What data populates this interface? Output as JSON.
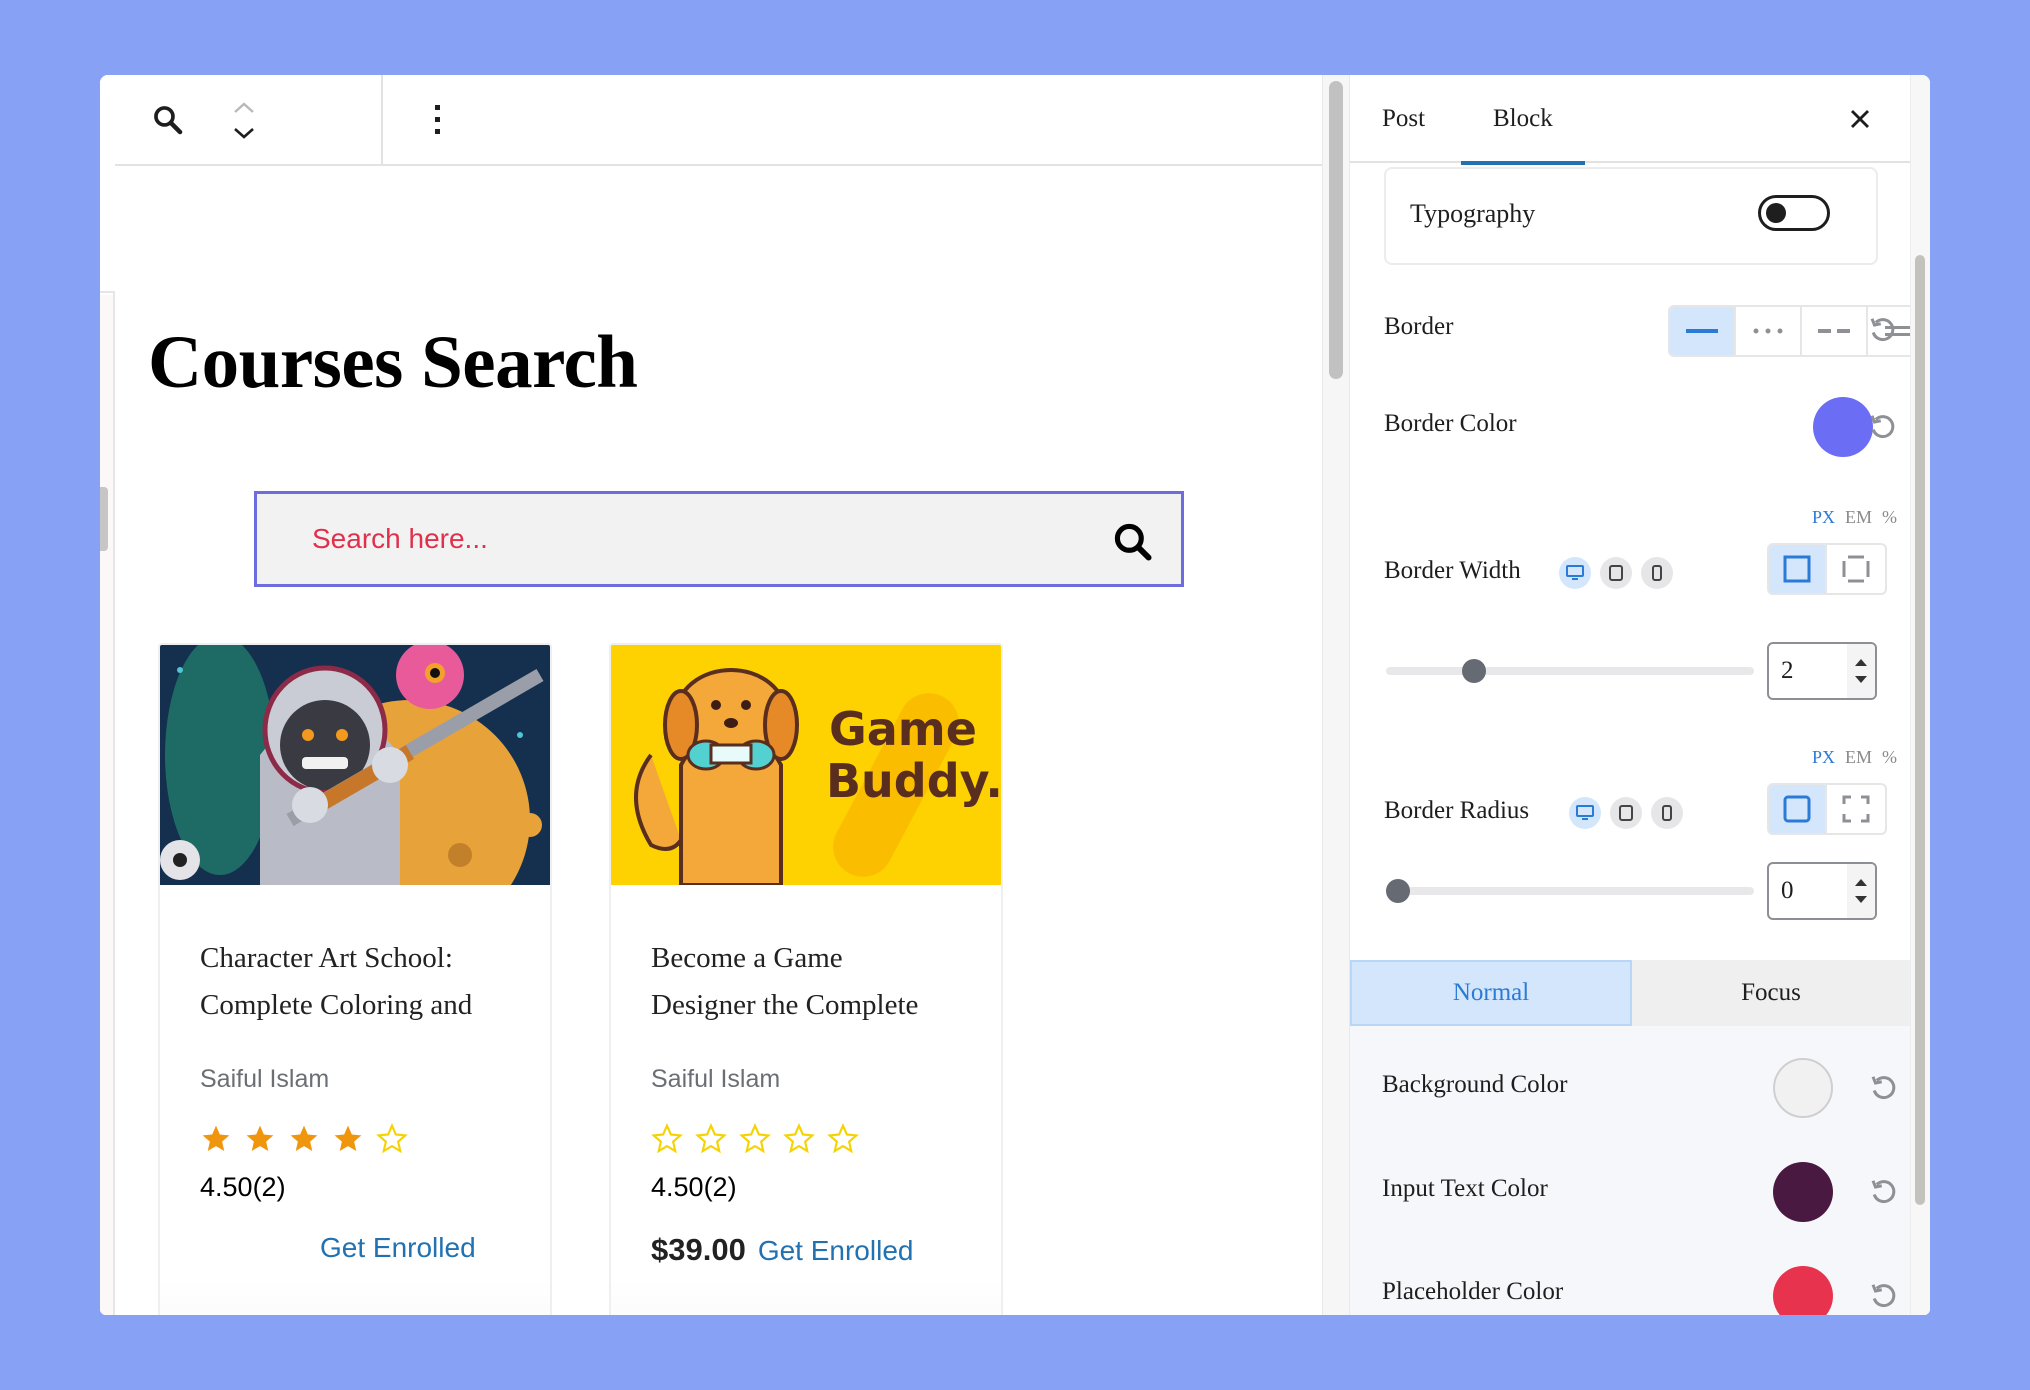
{
  "toolbar": {
    "search_icon": "search-icon",
    "up_icon": "chevron-up-icon",
    "down_icon": "chevron-down-icon",
    "more_icon": "more-vertical-icon"
  },
  "page": {
    "title": "Courses Search",
    "search": {
      "placeholder": "Search here...",
      "value": "",
      "submit_icon": "search-icon"
    }
  },
  "courses": [
    {
      "title_line1": "Character Art School:",
      "title_line2": "Complete Coloring and",
      "author": "Saiful Islam",
      "stars_filled": 4,
      "stars_total": 5,
      "rating": "4.50",
      "rating_count": "(2)",
      "price": "",
      "cta": "Get Enrolled",
      "image": "astronaut-gorilla-illustration"
    },
    {
      "title_line1": "Become a Game",
      "title_line2": "Designer the Complete",
      "author": "Saiful Islam",
      "stars_filled": 0,
      "stars_total": 5,
      "rating": "4.50",
      "rating_count": "(2)",
      "price": "$39.00",
      "cta": "Get Enrolled",
      "image": "game-buddy-dog-illustration",
      "image_text_1": "Game",
      "image_text_2": "Buddy."
    }
  ],
  "sidebar": {
    "tabs": [
      {
        "label": "Post",
        "active": false
      },
      {
        "label": "Block",
        "active": true
      }
    ],
    "close_icon": "close-icon",
    "typography": {
      "label": "Typography",
      "enabled": false
    },
    "border": {
      "label": "Border",
      "styles": [
        "solid",
        "dotted",
        "dashed",
        "double"
      ],
      "selected": "solid"
    },
    "border_color": {
      "label": "Border Color",
      "value": "#6b6ef5"
    },
    "border_width": {
      "label": "Border Width",
      "units": [
        "PX",
        "EM",
        "%"
      ],
      "unit_selected": "PX",
      "devices": [
        "desktop",
        "tablet",
        "mobile"
      ],
      "device_selected": "desktop",
      "link_modes": [
        "linked",
        "individual"
      ],
      "link_selected": "linked",
      "value": "2",
      "slider_fraction": 0.22
    },
    "border_radius": {
      "label": "Border Radius",
      "units": [
        "PX",
        "EM",
        "%"
      ],
      "unit_selected": "PX",
      "devices": [
        "desktop",
        "tablet",
        "mobile"
      ],
      "device_selected": "desktop",
      "link_modes": [
        "linked",
        "individual"
      ],
      "link_selected": "linked",
      "value": "0",
      "slider_fraction": 0
    },
    "state_tabs": [
      {
        "label": "Normal",
        "active": true
      },
      {
        "label": "Focus",
        "active": false
      }
    ],
    "colors": [
      {
        "label": "Background Color",
        "value": "#f1f1f1"
      },
      {
        "label": "Input Text Color",
        "value": "#4a1942"
      },
      {
        "label": "Placeholder Color",
        "value": "#e8334e"
      }
    ]
  },
  "theme": {
    "background": "#87a1f5",
    "accent": "#2271b1",
    "search_border": "#6e6de0",
    "star_filled": "#f0960e",
    "star_empty": "#f5d300"
  }
}
